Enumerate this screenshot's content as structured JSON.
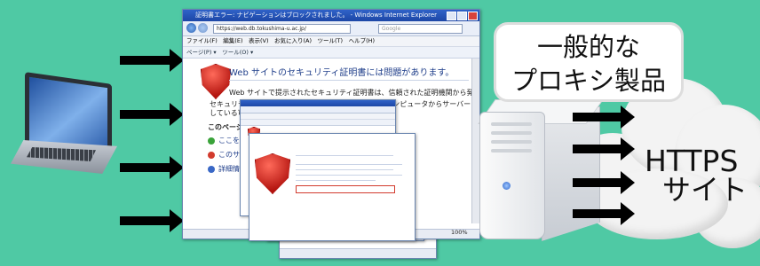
{
  "ie_window": {
    "title": "証明書エラー: ナビゲーションはブロックされました。 - Windows Internet Explorer",
    "url": "https://web.db.tokushima-u.ac.jp/",
    "search_placeholder": "Google",
    "menu": "ファイル(F)　編集(E)　表示(V)　お気に入り(A)　ツール(T)　ヘルプ(H)",
    "toolbar": "ページ(P) ▾　ツール(O) ▾",
    "heading": "Web サイトのセキュリティ証明書には問題があります。",
    "body_line1": "Web サイトで提示されたセキュリティ証明書は、信頼された証明機関から発行されたものではありません。",
    "body_line2": "セキュリティ証明書の問題によって、詐欺や、お使いのコンピュータからサーバーに送信される情報を盗み取る意図",
    "body_line3": "している可能性があります。",
    "recommend": "このページを",
    "option1": "ここをクリック",
    "option2": "このサイト",
    "option3": "詳細情報",
    "zoom": "100%"
  },
  "proxy_label": {
    "line1": "一般的な",
    "line2": "プロキシ製品"
  },
  "destination": {
    "line1": "HTTPS",
    "line2": "サイト"
  }
}
